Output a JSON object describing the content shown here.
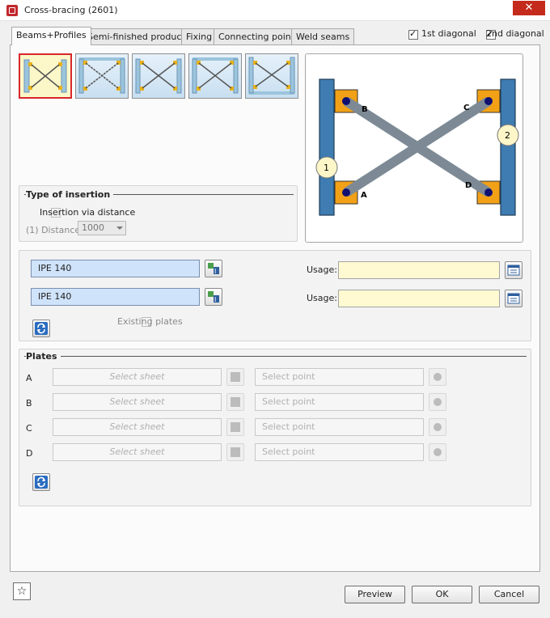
{
  "window": {
    "title": "Cross-bracing (2601)",
    "close_glyph": "✕"
  },
  "tabs": [
    {
      "label": "Beams+Profiles"
    },
    {
      "label": "Semi-finished products"
    },
    {
      "label": "Fixing"
    },
    {
      "label": "Connecting point"
    },
    {
      "label": "Weld seams"
    }
  ],
  "diagonals": {
    "first": "1st diagonal",
    "second": "2nd diagonal",
    "first_checked": true,
    "second_checked": true
  },
  "preview": {
    "column_left": "1",
    "column_right": "2",
    "point_a": "A",
    "point_b": "B",
    "point_c": "C",
    "point_d": "D"
  },
  "insertion": {
    "title": "Type of insertion",
    "via_distance": "Insertion via distance",
    "distance_label": "(1) Distance:",
    "distance_value": "1000"
  },
  "profiles": {
    "profile1": "IPE 140",
    "profile2": "IPE 140",
    "usage_label": "Usage:",
    "existing_plates": "Existing plates"
  },
  "plates": {
    "title": "Plates",
    "rows": [
      {
        "letter": "A",
        "sheet": "Select sheet",
        "point": "Select point"
      },
      {
        "letter": "B",
        "sheet": "Select sheet",
        "point": "Select point"
      },
      {
        "letter": "C",
        "sheet": "Select sheet",
        "point": "Select point"
      },
      {
        "letter": "D",
        "sheet": "Select sheet",
        "point": "Select point"
      }
    ]
  },
  "buttons": {
    "preview": "Preview",
    "ok": "OK",
    "cancel": "Cancel",
    "favorite_glyph": "☆"
  },
  "colors": {
    "accent_red": "#d8262b",
    "column_blue": "#3e7cb1",
    "plate_orange": "#f2a116",
    "brace_gray": "#7d8a96",
    "field_blue": "#cfe3fb",
    "field_yellow": "#fffad1"
  },
  "icons": [
    "app-icon",
    "close-icon",
    "profile-catalog-icon",
    "usage-list-icon",
    "refresh-icon",
    "sheet-catalog-icon",
    "point-select-icon",
    "star-icon"
  ]
}
